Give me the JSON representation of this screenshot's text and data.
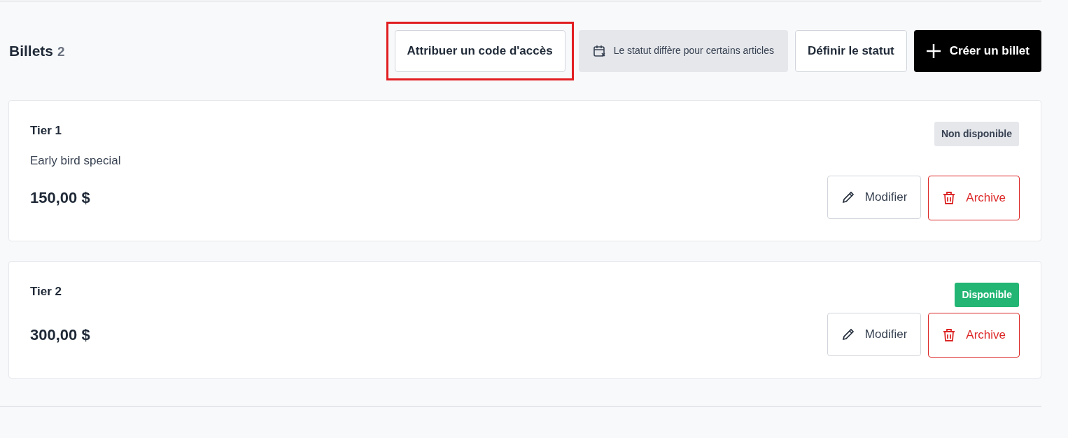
{
  "header": {
    "title": "Billets",
    "count": "2"
  },
  "actions": [
    {
      "kind": "outline",
      "label": "Attribuer un code d'accès",
      "highlighted": true
    },
    {
      "kind": "status-note",
      "label": "Le statut diffère pour certains articles",
      "highlighted": false
    },
    {
      "kind": "outline",
      "label": "Définir le statut",
      "highlighted": false
    },
    {
      "kind": "primary",
      "label": "Créer un billet",
      "highlighted": false
    }
  ],
  "tickets": [
    {
      "name": "Tier 1",
      "status": "Non disponible",
      "available": false,
      "description": "Early bird special",
      "price": "150,00 $",
      "edit": "Modifier",
      "archive": "Archive"
    },
    {
      "name": "Tier 2",
      "status": "Disponible",
      "available": true,
      "price": "300,00 $",
      "edit": "Modifier",
      "archive": "Archive"
    }
  ]
}
